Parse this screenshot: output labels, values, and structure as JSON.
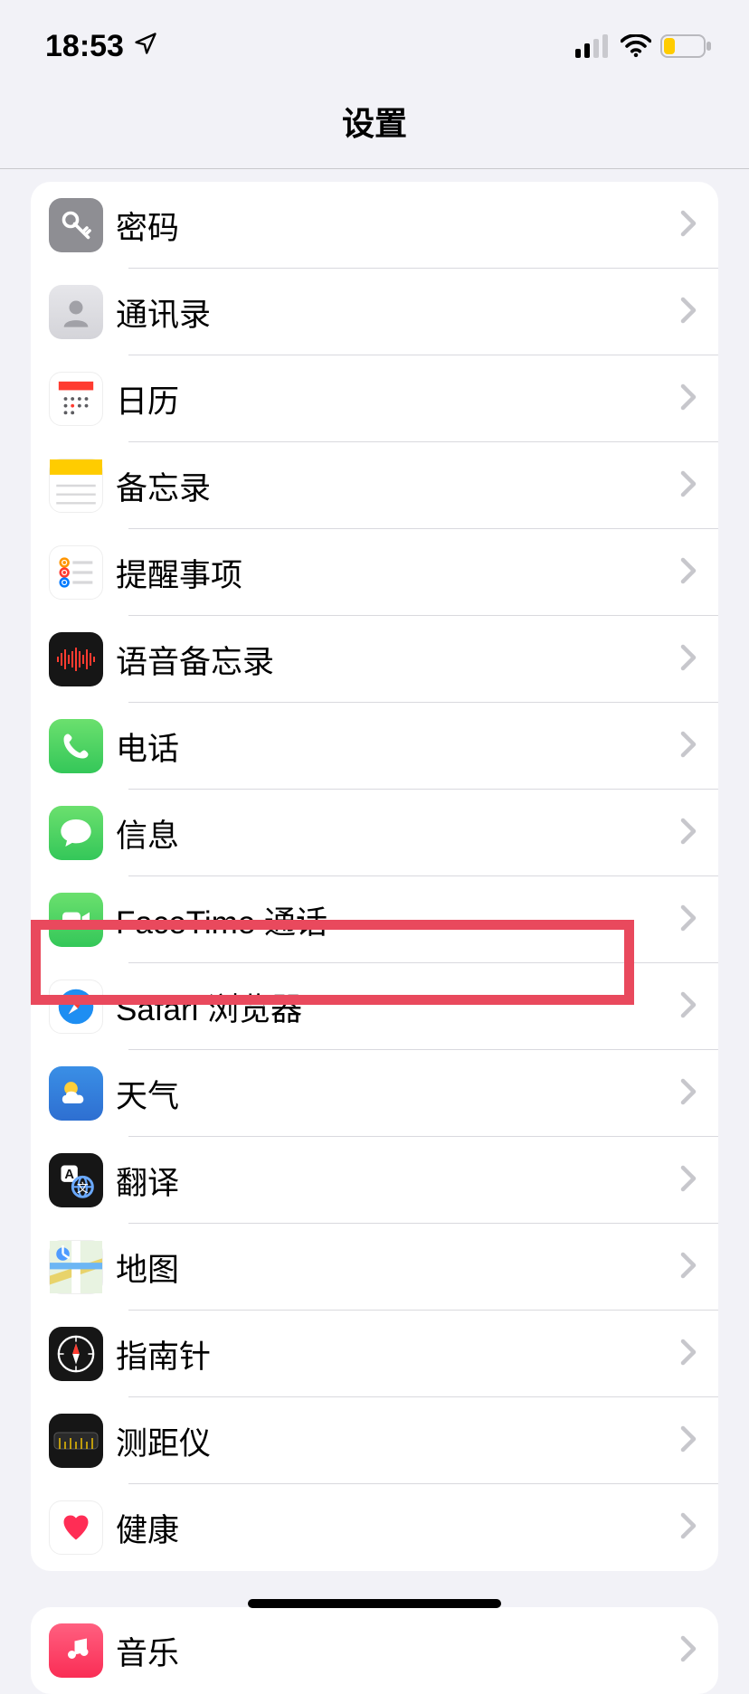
{
  "status": {
    "time": "18:53",
    "location_icon": "location-arrow",
    "cell_bars": 2,
    "wifi": true,
    "battery": "low"
  },
  "header": {
    "title": "设置"
  },
  "groups": [
    {
      "items": [
        {
          "id": "passwords",
          "label": "密码",
          "icon": "key-icon"
        },
        {
          "id": "contacts",
          "label": "通讯录",
          "icon": "contacts-icon"
        },
        {
          "id": "calendar",
          "label": "日历",
          "icon": "calendar-icon"
        },
        {
          "id": "notes",
          "label": "备忘录",
          "icon": "notes-icon"
        },
        {
          "id": "reminders",
          "label": "提醒事项",
          "icon": "reminders-icon"
        },
        {
          "id": "voicememos",
          "label": "语音备忘录",
          "icon": "voice-memos-icon"
        },
        {
          "id": "phone",
          "label": "电话",
          "icon": "phone-icon"
        },
        {
          "id": "messages",
          "label": "信息",
          "icon": "messages-icon"
        },
        {
          "id": "facetime",
          "label": "FaceTime 通话",
          "icon": "facetime-icon"
        },
        {
          "id": "safari",
          "label": "Safari 浏览器",
          "icon": "safari-icon",
          "highlighted": true
        },
        {
          "id": "weather",
          "label": "天气",
          "icon": "weather-icon"
        },
        {
          "id": "translate",
          "label": "翻译",
          "icon": "translate-icon"
        },
        {
          "id": "maps",
          "label": "地图",
          "icon": "maps-icon"
        },
        {
          "id": "compass",
          "label": "指南针",
          "icon": "compass-icon"
        },
        {
          "id": "measure",
          "label": "测距仪",
          "icon": "measure-icon"
        },
        {
          "id": "health",
          "label": "健康",
          "icon": "health-icon"
        }
      ]
    },
    {
      "items": [
        {
          "id": "music",
          "label": "音乐",
          "icon": "music-icon"
        }
      ]
    }
  ],
  "colors": {
    "highlight": "#e9495d"
  }
}
